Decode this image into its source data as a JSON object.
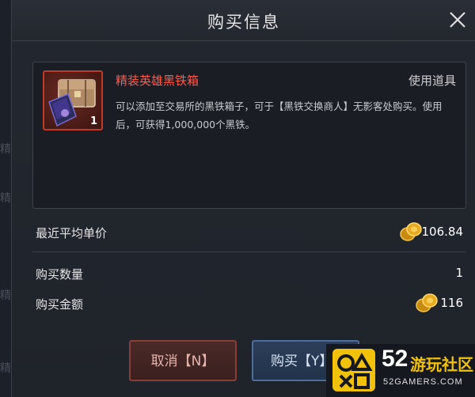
{
  "background": {
    "side_chars": [
      "精",
      "精",
      "精",
      "精"
    ]
  },
  "dialog": {
    "title": "购买信息"
  },
  "item": {
    "name": "精装英雄黑铁箱",
    "type": "使用道具",
    "quantity": "1",
    "description": "可以添加至交易所的黑铁箱子，可于【黑铁交换商人】无影客处购买。使用后，可获得1,000,000个黑铁。",
    "name_color": "#ff5a4a",
    "border_color": "#c0392b"
  },
  "price_rows": {
    "avg_price_label": "最近平均单价",
    "avg_price_value": "106.84",
    "quantity_label": "购买数量",
    "quantity_value": "1",
    "total_label": "购买金额",
    "total_value": "116"
  },
  "buttons": {
    "cancel_label": "取消【N】",
    "buy_label": "购买【Y】"
  },
  "watermark": {
    "number": "52",
    "cn_text": "游玩社区",
    "en_text": "52GAMERS.COM"
  },
  "colors": {
    "accent_red": "#ff5a4a",
    "coin_gold": "#e8a923",
    "cancel_border": "#8a3e36",
    "buy_border": "#4d6d9a"
  }
}
